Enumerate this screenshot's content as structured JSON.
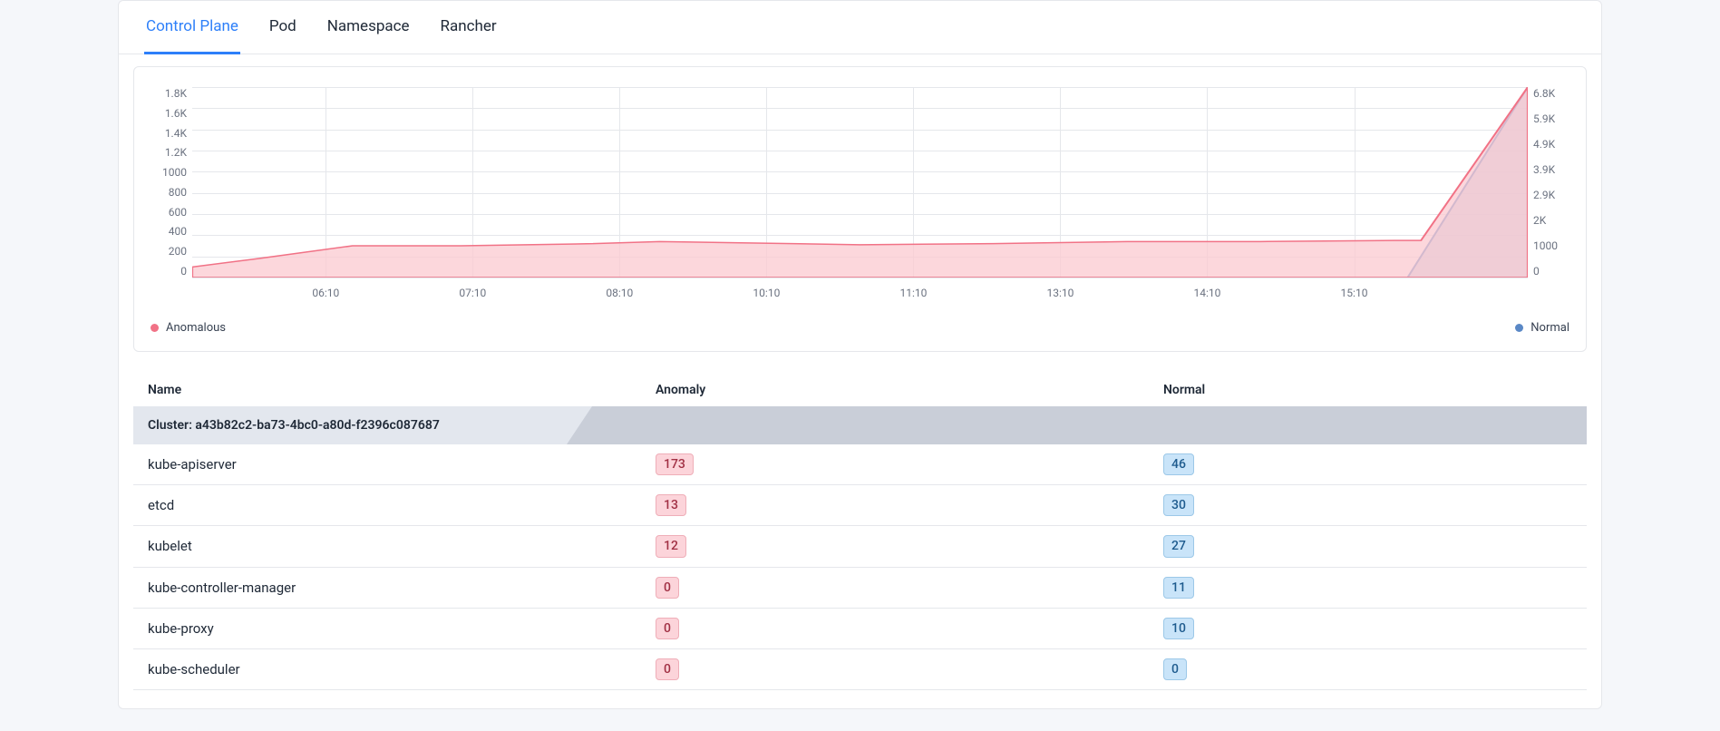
{
  "tabs": [
    "Control Plane",
    "Pod",
    "Namespace",
    "Rancher"
  ],
  "active_tab": 0,
  "legend": {
    "anomalous": "Anomalous",
    "normal": "Normal"
  },
  "colors": {
    "anomalous": "#f17286",
    "normal": "#5a88c6",
    "anomalous_fill": "#fbc9d0",
    "normal_fill": "#b9c3dd"
  },
  "chart_data": {
    "type": "area",
    "x_categories": [
      "06:10",
      "07:10",
      "08:10",
      "10:10",
      "11:10",
      "13:10",
      "14:10",
      "15:10"
    ],
    "y_left_ticks": [
      "1.8K",
      "1.6K",
      "1.4K",
      "1.2K",
      "1000",
      "800",
      "600",
      "400",
      "200",
      "0"
    ],
    "y_right_ticks": [
      "6.8K",
      "5.9K",
      "4.9K",
      "3.9K",
      "2.9K",
      "2K",
      "1000",
      "0"
    ],
    "y_left_range": [
      0,
      1800
    ],
    "y_right_range": [
      0,
      6800
    ],
    "series": [
      {
        "name": "Anomalous",
        "axis": "left",
        "values": [
          [
            0.0,
            100
          ],
          [
            0.05,
            180
          ],
          [
            0.12,
            300
          ],
          [
            0.2,
            300
          ],
          [
            0.3,
            320
          ],
          [
            0.35,
            340
          ],
          [
            0.4,
            330
          ],
          [
            0.5,
            310
          ],
          [
            0.6,
            320
          ],
          [
            0.65,
            330
          ],
          [
            0.7,
            340
          ],
          [
            0.8,
            340
          ],
          [
            0.9,
            350
          ],
          [
            0.92,
            350
          ],
          [
            1.0,
            1800
          ]
        ]
      },
      {
        "name": "Normal",
        "axis": "right",
        "values": [
          [
            0.0,
            0
          ],
          [
            0.91,
            0
          ],
          [
            1.0,
            6800
          ]
        ]
      }
    ]
  },
  "table": {
    "headers": {
      "name": "Name",
      "anomaly": "Anomaly",
      "normal": "Normal"
    },
    "group_label_prefix": "Cluster: ",
    "group_label_id": "a43b82c2-ba73-4bc0-a80d-f2396c087687",
    "rows": [
      {
        "name": "kube-apiserver",
        "anomaly": 173,
        "normal": 46
      },
      {
        "name": "etcd",
        "anomaly": 13,
        "normal": 30
      },
      {
        "name": "kubelet",
        "anomaly": 12,
        "normal": 27
      },
      {
        "name": "kube-controller-manager",
        "anomaly": 0,
        "normal": 11
      },
      {
        "name": "kube-proxy",
        "anomaly": 0,
        "normal": 10
      },
      {
        "name": "kube-scheduler",
        "anomaly": 0,
        "normal": 0
      }
    ]
  }
}
